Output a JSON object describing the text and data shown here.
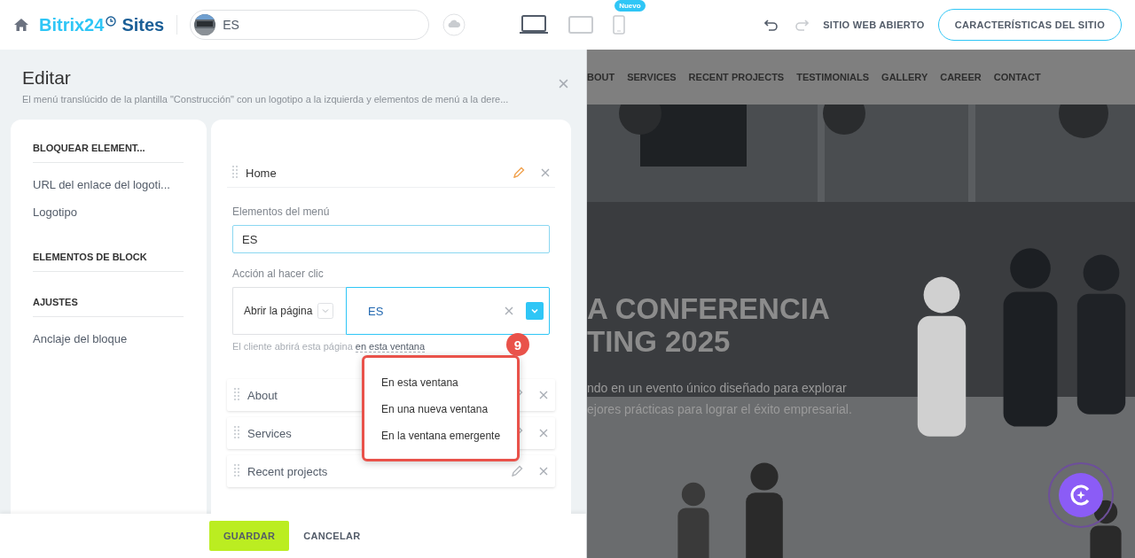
{
  "topbar": {
    "logo": {
      "brand": "Bitrix24",
      "product": "Sites"
    },
    "site_selector": {
      "value": "ES"
    },
    "devices": [
      {
        "kind": "desktop",
        "selected": true
      },
      {
        "kind": "tablet",
        "selected": false
      },
      {
        "kind": "mobile",
        "selected": false,
        "badge": "Nuevo"
      }
    ],
    "undo": {
      "disabled": false
    },
    "redo": {
      "disabled": true
    },
    "open_site_link": "SITIO WEB ABIERTO",
    "features_button": "CARACTERÍSTICAS DEL SITIO"
  },
  "editor": {
    "title": "Editar",
    "subtitle": "El menú translúcido de la plantilla \"Construcción\" con un logotipo a la izquierda y elementos de menú a la dere...",
    "sidebar": [
      {
        "heading": "BLOQUEAR ELEMENT...",
        "items": [
          "URL del enlace del logoti...",
          "Logotipo"
        ]
      },
      {
        "heading": "ELEMENTOS DE BLOCK"
      },
      {
        "heading": "AJUSTES",
        "items": [
          "Anclaje del bloque"
        ]
      }
    ],
    "menu_items": [
      {
        "label": "Home",
        "editing": true
      },
      {
        "label": "About",
        "editing": false
      },
      {
        "label": "Services",
        "editing": false
      },
      {
        "label": "Recent projects",
        "editing": false
      }
    ],
    "item_form": {
      "name_label": "Elementos del menú",
      "name_value": "ES",
      "action_label": "Acción al hacer clic",
      "action_type": "Abrir la página",
      "action_target": "ES",
      "hint": "El cliente abrirá esta página",
      "hint_link": "en esta ventana"
    },
    "dropdown": {
      "options": [
        "En esta ventana",
        "En una nueva ventana",
        "En la ventana emergente"
      ],
      "annotation_badge": "9"
    },
    "footer_buttons": [
      {
        "label": "GUARDAR",
        "kind": "primary"
      },
      {
        "label": "CANCELAR",
        "kind": "plain"
      }
    ]
  },
  "preview": {
    "nav": [
      "BOUT",
      "SERVICES",
      "RECENT PROJECTS",
      "TESTIMONIALS",
      "GALLERY",
      "CAREER",
      "CONTACT"
    ],
    "hero_title": [
      "A CONFERENCIA",
      "TING 2025"
    ],
    "hero_text": [
      "ndo en un evento único diseñado para explorar",
      "ejores prácticas para lograr el éxito empresarial."
    ]
  }
}
